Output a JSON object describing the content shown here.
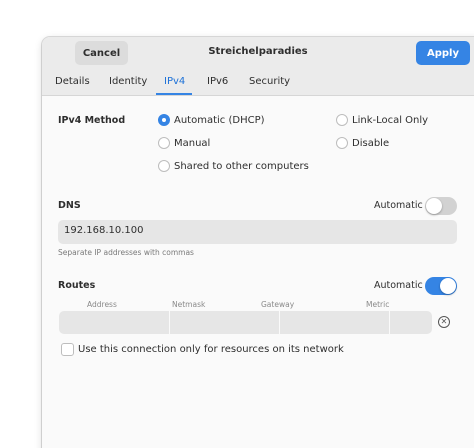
{
  "header": {
    "cancel_label": "Cancel",
    "title": "Streichelparadies",
    "apply_label": "Apply",
    "accent": "#3584e4"
  },
  "tabs": [
    {
      "label": "Details",
      "active": false
    },
    {
      "label": "Identity",
      "active": false
    },
    {
      "label": "IPv4",
      "active": true
    },
    {
      "label": "IPv6",
      "active": false
    },
    {
      "label": "Security",
      "active": false
    }
  ],
  "ipv4": {
    "method_label": "IPv4 Method",
    "options": [
      {
        "label": "Automatic (DHCP)",
        "checked": true
      },
      {
        "label": "Link-Local Only",
        "checked": false
      },
      {
        "label": "Manual",
        "checked": false
      },
      {
        "label": "Disable",
        "checked": false
      },
      {
        "label": "Shared to other computers",
        "checked": false
      }
    ]
  },
  "dns": {
    "label": "DNS",
    "automatic_label": "Automatic",
    "automatic_on": false,
    "value": "192.168.10.100",
    "hint": "Separate IP addresses with commas"
  },
  "routes": {
    "label": "Routes",
    "automatic_label": "Automatic",
    "automatic_on": true,
    "columns": [
      "Address",
      "Netmask",
      "Gateway",
      "Metric"
    ],
    "only_resources_label": "Use this connection only for resources on its network",
    "only_resources_checked": false
  }
}
